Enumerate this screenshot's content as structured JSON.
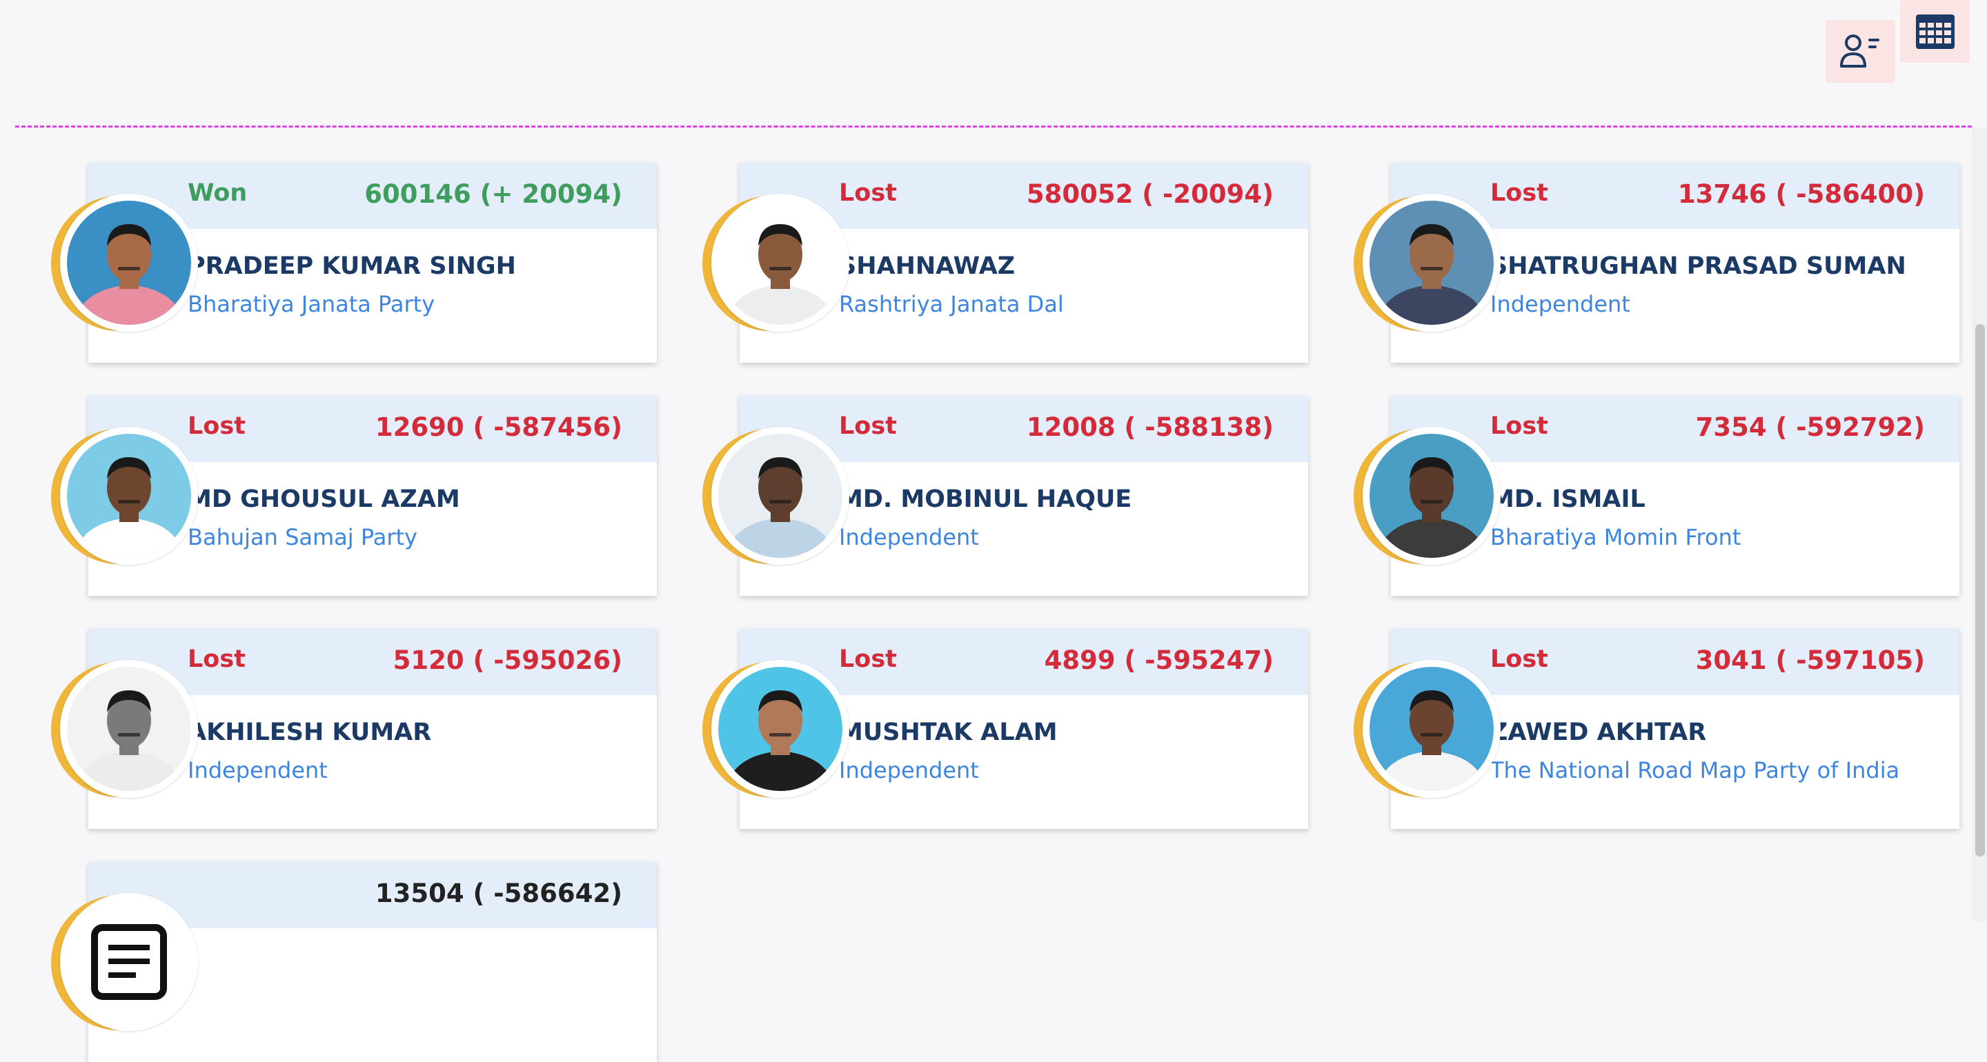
{
  "toolbar": {
    "list_view_icon": "user-list-icon",
    "grid_view_icon": "grid-table-icon"
  },
  "colors": {
    "won": "#3f9d5d",
    "lost": "#d42b3a",
    "name": "#1c3a66",
    "party": "#3d86e0",
    "card_header": "#e4eefa",
    "ring": "#efb63a",
    "divider": "#e13fe6"
  },
  "candidates": [
    {
      "status": "Won",
      "votes": "600146 (+ 20094)",
      "name": "PRADEEP KUMAR SINGH",
      "party": "Bharatiya Janata Party",
      "photo_bg": "#3a8fc4",
      "shirt": "#e98da0",
      "skin": "#a86a47"
    },
    {
      "status": "Lost",
      "votes": "580052 ( -20094)",
      "name": "SHAHNAWAZ",
      "party": "Rashtriya Janata Dal",
      "photo_bg": "#ffffff",
      "shirt": "#ededed",
      "skin": "#8a5a3c"
    },
    {
      "status": "Lost",
      "votes": "13746 ( -586400)",
      "name": "SHATRUGHAN PRASAD SUMAN",
      "party": "Independent",
      "photo_bg": "#5e8fb5",
      "shirt": "#3d4660",
      "skin": "#9a6a4a"
    },
    {
      "status": "Lost",
      "votes": "12690 ( -587456)",
      "name": "MD GHOUSUL AZAM",
      "party": "Bahujan Samaj Party",
      "photo_bg": "#7dcbe6",
      "shirt": "#ffffff",
      "skin": "#6e4630"
    },
    {
      "status": "Lost",
      "votes": "12008 ( -588138)",
      "name": "MD. MOBINUL HAQUE",
      "party": "Independent",
      "photo_bg": "#e8eef2",
      "shirt": "#bcd4e6",
      "skin": "#5e3e2e"
    },
    {
      "status": "Lost",
      "votes": "7354 ( -592792)",
      "name": "MD. ISMAIL",
      "party": "Bharatiya Momin Front",
      "photo_bg": "#4a9ec4",
      "shirt": "#3c3c3c",
      "skin": "#5a3a2a"
    },
    {
      "status": "Lost",
      "votes": "5120 ( -595026)",
      "name": "AKHILESH KUMAR",
      "party": "Independent",
      "photo_bg": "#f2f2f2",
      "shirt": "#ececec",
      "skin": "#7a7a7a"
    },
    {
      "status": "Lost",
      "votes": "4899 ( -595247)",
      "name": "MUSHTAK ALAM",
      "party": "Independent",
      "photo_bg": "#4fc4e6",
      "shirt": "#1e1e1e",
      "skin": "#b07a5a"
    },
    {
      "status": "Lost",
      "votes": "3041 ( -597105)",
      "name": "ZAWED AKHTAR",
      "party": "The National Road Map Party of India",
      "photo_bg": "#4aa8d8",
      "shirt": "#f4f4f4",
      "skin": "#6a4430"
    },
    {
      "status": "",
      "votes": "13504 ( -586642)",
      "name": "",
      "party": "",
      "photo_bg": "#ffffff",
      "shirt": "#ffffff",
      "skin": "#ffffff",
      "is_nota": true
    }
  ]
}
